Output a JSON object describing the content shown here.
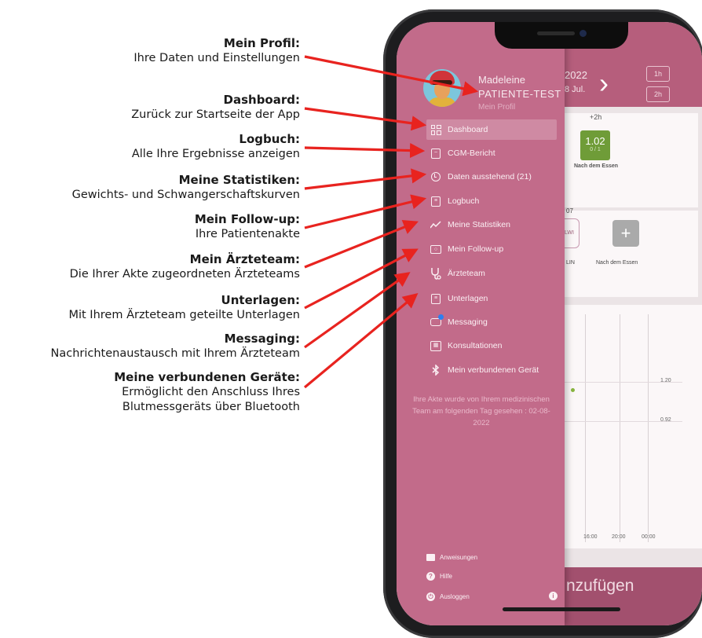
{
  "annotations": [
    {
      "title": "Mein Profil:",
      "desc": "Ihre Daten und Einstellungen"
    },
    {
      "title": "Dashboard:",
      "desc": "Zurück zur Startseite der App"
    },
    {
      "title": "Logbuch:",
      "desc": "Alle Ihre Ergebnisse anzeigen"
    },
    {
      "title": "Meine Statistiken:",
      "desc": "Gewichts- und Schwangerschaftskurven"
    },
    {
      "title": "Mein Follow-up:",
      "desc": "Ihre Patientenakte"
    },
    {
      "title": "Mein Ärzteteam:",
      "desc": "Die Ihrer Akte zugeordneten Ärzteteams"
    },
    {
      "title": "Unterlagen:",
      "desc": "Mit Ihrem Ärzteteam geteilte Unterlagen"
    },
    {
      "title": "Messaging:",
      "desc": "Nachrichtenaustausch mit Ihrem Ärzteteam"
    },
    {
      "title": "Meine verbundenen Geräte:",
      "desc": "Ermöglicht den Anschluss Ihres",
      "desc2": "Blutmessgeräts über Bluetooth"
    }
  ],
  "profile": {
    "first_name": "Madeleine",
    "last_name": "PATIENTE-TEST",
    "link": "Mein Profil"
  },
  "menu": [
    {
      "label": "Dashboard",
      "icon": "grid-icon"
    },
    {
      "label": "CGM-Bericht",
      "icon": "report-icon"
    },
    {
      "label": "Daten ausstehend (21)",
      "icon": "clock-icon"
    },
    {
      "label": "Logbuch",
      "icon": "logbook-icon"
    },
    {
      "label": "Meine Statistiken",
      "icon": "chart-icon"
    },
    {
      "label": "Mein Follow-up",
      "icon": "camera-icon"
    },
    {
      "label": "Ärzteteam",
      "icon": "stethoscope-icon"
    },
    {
      "label": "Unterlagen",
      "icon": "document-icon"
    },
    {
      "label": "Messaging",
      "icon": "message-icon"
    },
    {
      "label": "Konsultationen",
      "icon": "calendar-icon"
    },
    {
      "label": "Mein verbundenen Gerät",
      "icon": "bluetooth-icon"
    }
  ],
  "note": "Ihre Akte wurde von Ihrem medizinischen Team am folgenden Tag gesehen : 02-08-2022",
  "footer": {
    "instructions": "Anweisungen",
    "help": "Hilfe",
    "logout": "Ausloggen"
  },
  "background": {
    "date_line1": "2022",
    "date_line2": "8 Jul.",
    "time_labels": [
      "1h",
      "2h"
    ],
    "offset": "+2h",
    "glucose_value": "1.02",
    "glucose_sub": "0 / 1",
    "after_meal": "Nach dem Essen",
    "date_label": "07",
    "lw": "LWI",
    "lin": "LIN",
    "after_meal2": "Nach dem Essen",
    "y_labels": [
      "1.20",
      "0.92"
    ],
    "x_labels": [
      "16:00",
      "20:00",
      "00:00"
    ],
    "add_text": "nzufügen"
  }
}
